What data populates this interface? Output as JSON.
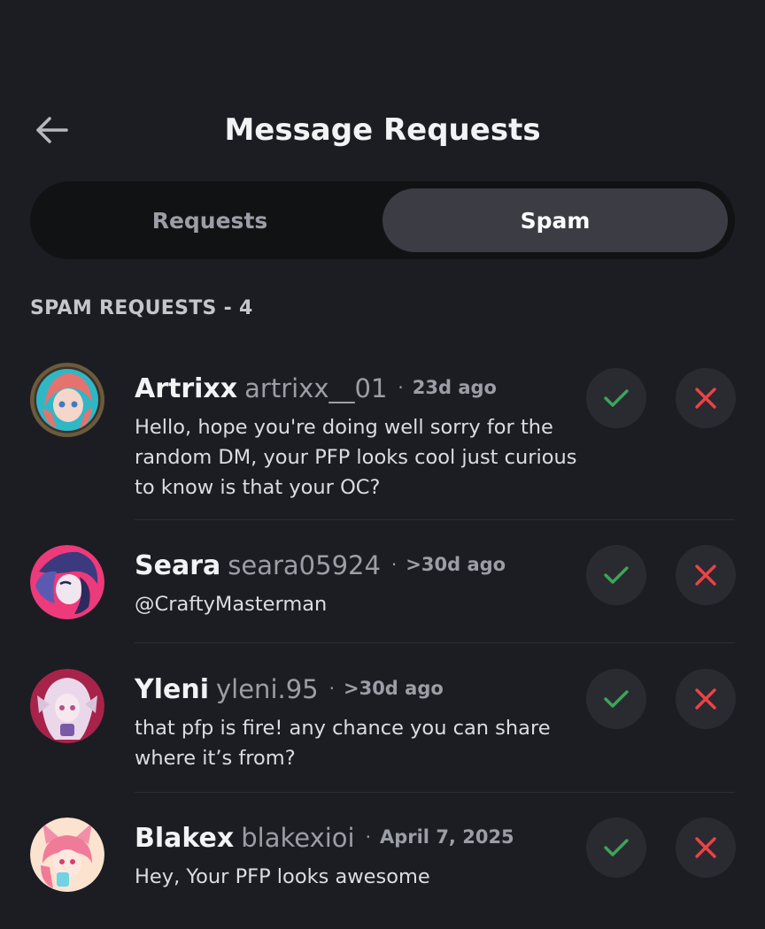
{
  "header": {
    "title": "Message Requests",
    "back_icon": "arrow-left-icon"
  },
  "tabs": [
    {
      "label": "Requests",
      "active": false
    },
    {
      "label": "Spam",
      "active": true
    }
  ],
  "section_label": "SPAM REQUESTS - 4",
  "requests": [
    {
      "display_name": "Artrixx",
      "username": "artrixx__01",
      "separator": "·",
      "time": "23d ago",
      "message": "Hello, hope you're doing well sorry for the random DM, your PFP looks cool just curious to know is that your OC?"
    },
    {
      "display_name": "Seara",
      "username": "seara05924",
      "separator": "·",
      "time": ">30d ago",
      "message": "@CraftyMasterman"
    },
    {
      "display_name": "Yleni",
      "username": "yleni.95",
      "separator": "·",
      "time": ">30d ago",
      "message": "that pfp is fire! any chance you can share where it’s from?"
    },
    {
      "display_name": "Blakex",
      "username": "blakexioi",
      "separator": "·",
      "time": "April 7, 2025",
      "message": "Hey, Your PFP looks awesome"
    }
  ],
  "colors": {
    "background": "#1c1d22",
    "accept": "#3ba55c",
    "reject": "#ed4245",
    "active_tab": "#3b3c44"
  },
  "icons": {
    "accept": "checkmark-icon",
    "reject": "close-x-icon"
  }
}
